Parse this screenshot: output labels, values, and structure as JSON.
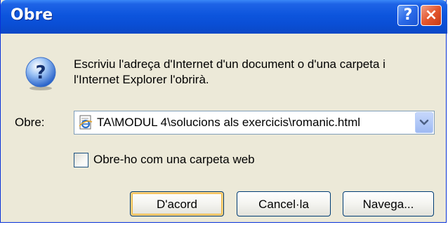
{
  "window": {
    "title": "Obre",
    "help_label": "?",
    "close_label": "×"
  },
  "dialog": {
    "icon": "question-icon",
    "message": "Escriviu l'adreça d'Internet d'un document o d'una carpeta i l'Internet Explorer l'obrirà.",
    "open_label": "Obre:",
    "address_value": "TA\\MODUL 4\\solucions als exercicis\\romanic.html",
    "address_icon": "ie-page-icon",
    "webfolder_checkbox_label": "Obre-ho com una carpeta web",
    "webfolder_checked": false
  },
  "buttons": {
    "ok_label": "D'acord",
    "cancel_label": "Cancel·la",
    "browse_label": "Navega..."
  },
  "colors": {
    "titlebar": "#0a4fd6",
    "dialog_bg": "#ece9d8",
    "close_button": "#e4572e",
    "default_button_focus": "#f2b845"
  }
}
